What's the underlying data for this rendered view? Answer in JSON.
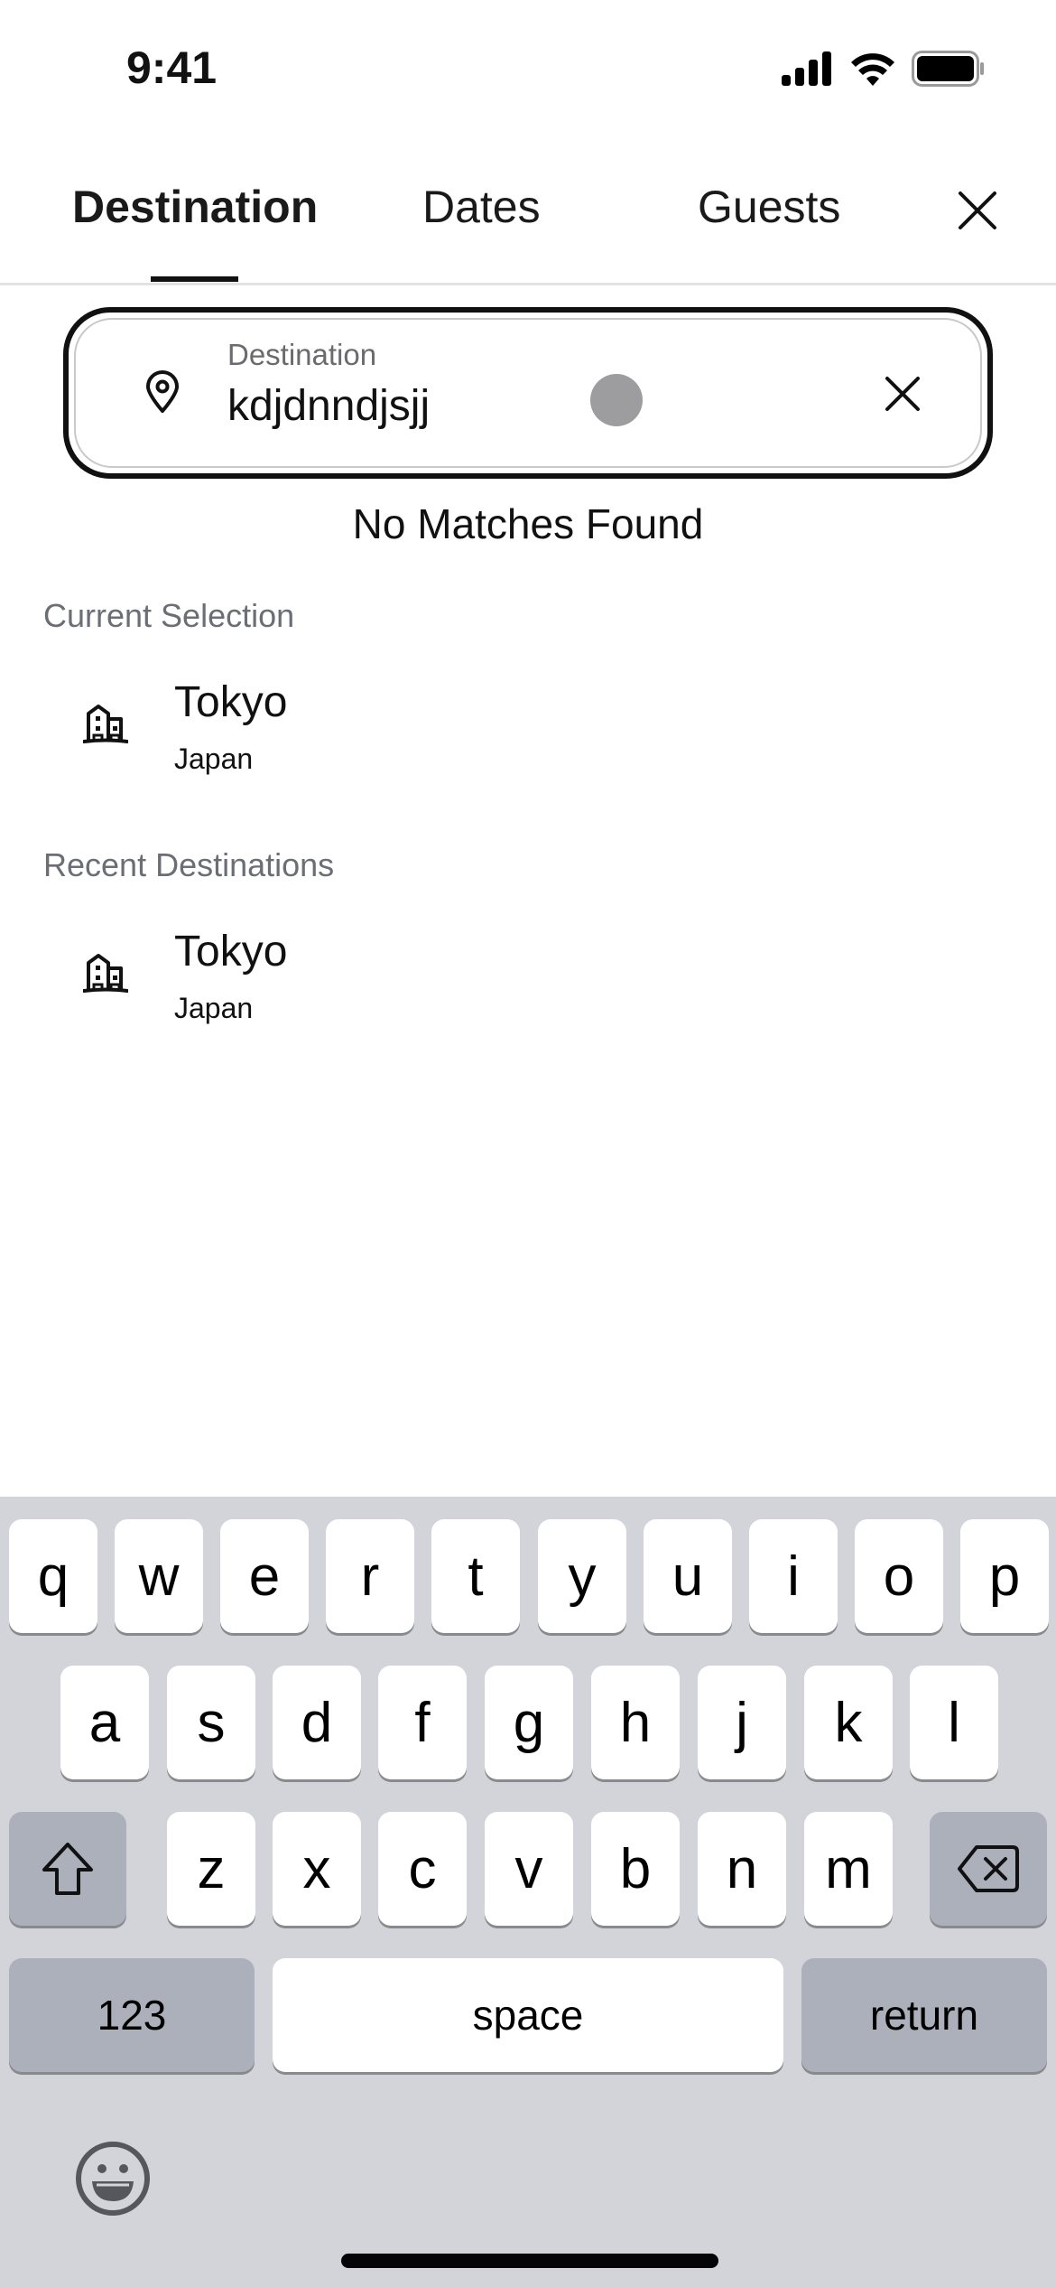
{
  "status_bar": {
    "time": "9:41",
    "icons": [
      "cellular-signal-icon",
      "wifi-icon",
      "battery-icon"
    ]
  },
  "tabs": [
    {
      "label": "Destination",
      "active": true
    },
    {
      "label": "Dates",
      "active": false
    },
    {
      "label": "Guests",
      "active": false
    }
  ],
  "header": {
    "close_icon": "close-icon"
  },
  "search": {
    "label": "Destination",
    "value": "kdjdnndjsjj",
    "leading_icon": "map-pin-icon",
    "clear_icon": "clear-icon"
  },
  "results": {
    "empty_message": "No Matches Found"
  },
  "sections": [
    {
      "heading": "Current Selection",
      "items": [
        {
          "city": "Tokyo",
          "country": "Japan",
          "icon": "building-icon"
        }
      ]
    },
    {
      "heading": "Recent Destinations",
      "items": [
        {
          "city": "Tokyo",
          "country": "Japan",
          "icon": "building-icon"
        }
      ]
    }
  ],
  "keyboard": {
    "row1": [
      "q",
      "w",
      "e",
      "r",
      "t",
      "y",
      "u",
      "i",
      "o",
      "p"
    ],
    "row2": [
      "a",
      "s",
      "d",
      "f",
      "g",
      "h",
      "j",
      "k",
      "l"
    ],
    "row3": [
      "z",
      "x",
      "c",
      "v",
      "b",
      "n",
      "m"
    ],
    "shift_icon": "shift-icon",
    "delete_icon": "backspace-icon",
    "numbers_label": "123",
    "space_label": "space",
    "return_label": "return",
    "emoji_icon": "emoji-icon"
  },
  "colors": {
    "keyboard_bg": "#d3d4d9",
    "key_bg": "#ffffff",
    "function_key_bg": "#abb0bb",
    "muted_text": "#6b6e75"
  }
}
